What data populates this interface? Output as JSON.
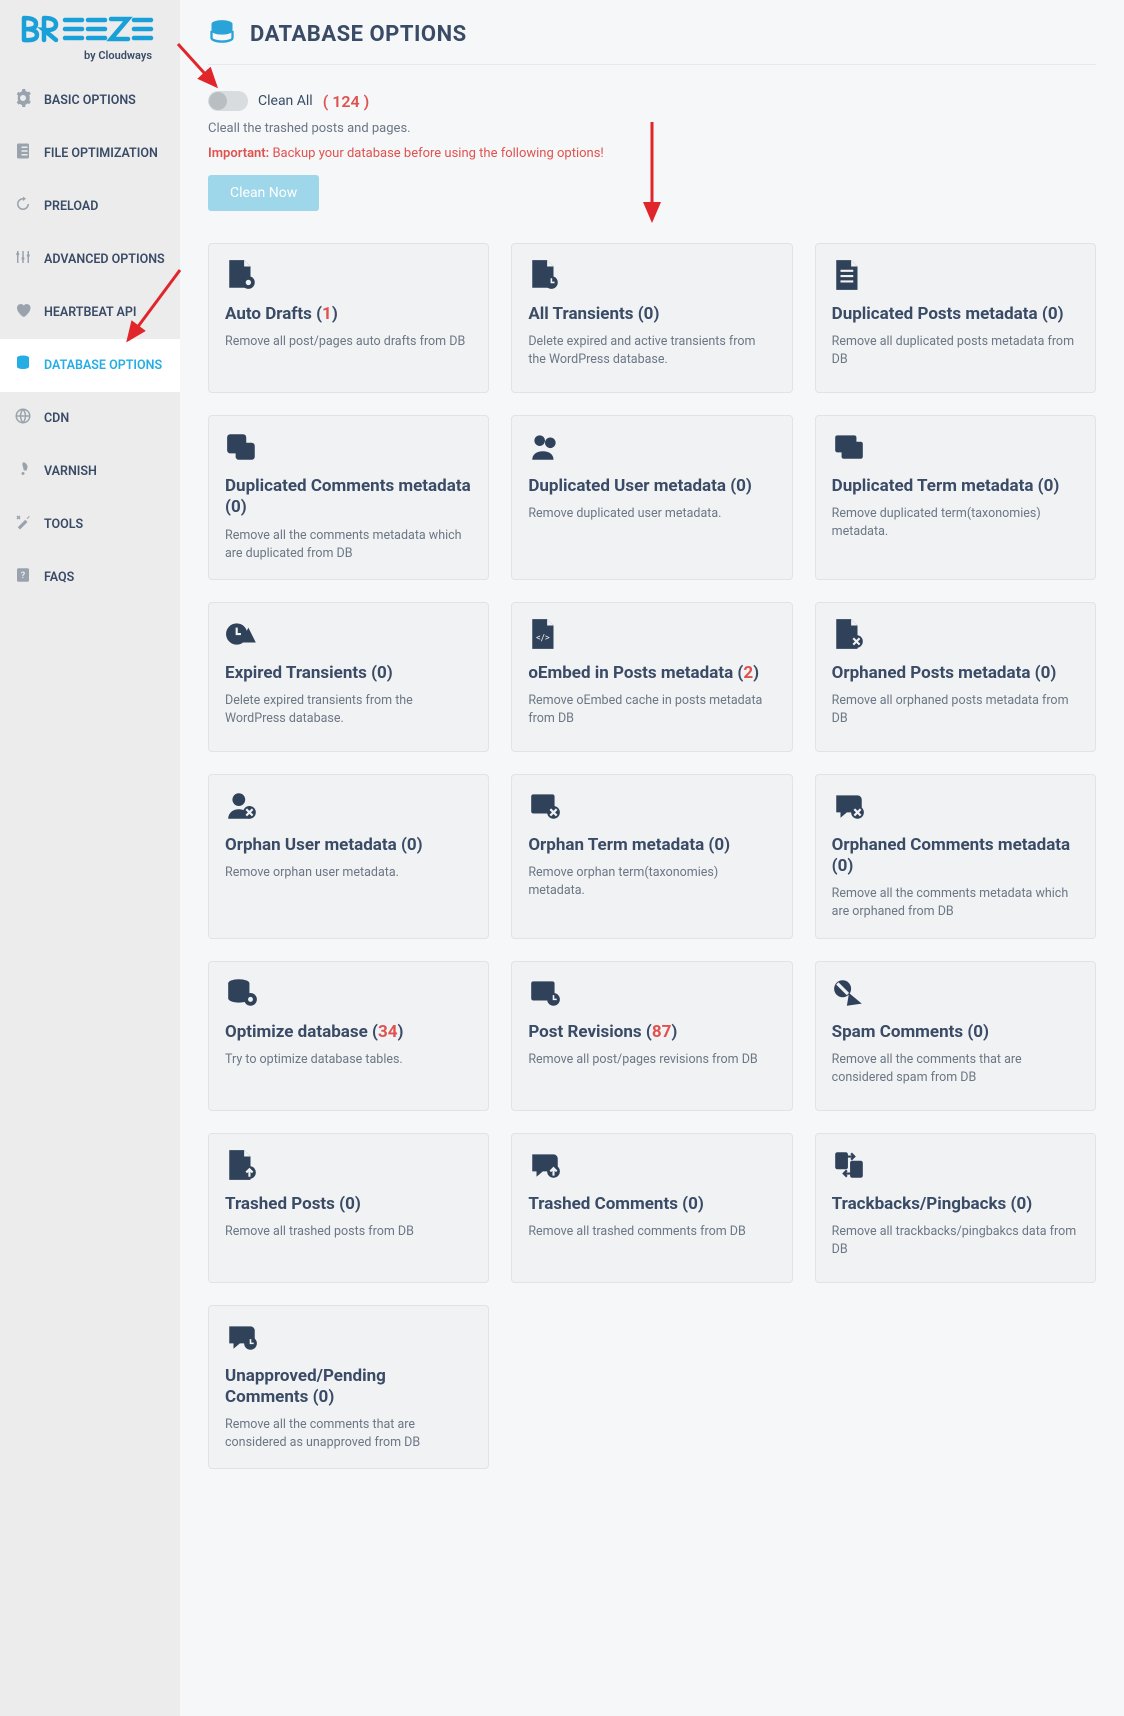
{
  "logo_sub": "by Cloudways",
  "header": {
    "title": "DATABASE OPTIONS"
  },
  "nav": [
    {
      "id": "basic",
      "label": "BASIC OPTIONS"
    },
    {
      "id": "fileopt",
      "label": "FILE OPTIMIZATION"
    },
    {
      "id": "preload",
      "label": "PRELOAD"
    },
    {
      "id": "advanced",
      "label": "ADVANCED OPTIONS"
    },
    {
      "id": "heartbeat",
      "label": "HEARTBEAT API"
    },
    {
      "id": "database",
      "label": "DATABASE OPTIONS",
      "active": true
    },
    {
      "id": "cdn",
      "label": "CDN"
    },
    {
      "id": "varnish",
      "label": "VARNISH"
    },
    {
      "id": "tools",
      "label": "TOOLS"
    },
    {
      "id": "faqs",
      "label": "FAQS"
    }
  ],
  "clean": {
    "label": "Clean All",
    "count_text": "( 124 )",
    "desc": "Cleall the trashed posts and pages.",
    "warn_label": "Important:",
    "warn_text": " Backup your database before using the following options!",
    "button": "Clean Now"
  },
  "cards": [
    {
      "id": "autodrafts",
      "icon": "file-gear",
      "title": "Auto Drafts",
      "count": "1",
      "red": true,
      "desc": "Remove all post/pages auto drafts from DB"
    },
    {
      "id": "alltransients",
      "icon": "file-clock",
      "title": "All Transients",
      "count": "0",
      "red": false,
      "desc": "Delete expired and active transients from the WordPress database."
    },
    {
      "id": "dup-posts-meta",
      "icon": "file-lines",
      "title": "Duplicated Posts metadata",
      "count": "0",
      "red": false,
      "desc": "Remove all duplicated posts metadata from DB"
    },
    {
      "id": "dup-comments-meta",
      "icon": "layers",
      "title": "Duplicated Comments metadata",
      "count": "0",
      "red": false,
      "desc": "Remove all the comments metadata which are duplicated from DB"
    },
    {
      "id": "dup-user-meta",
      "icon": "user-dup",
      "title": "Duplicated User metadata",
      "count": "0",
      "red": false,
      "desc": "Remove duplicated user metadata."
    },
    {
      "id": "dup-term-meta",
      "icon": "term-dup",
      "title": "Duplicated Term metadata",
      "count": "0",
      "red": false,
      "desc": "Remove duplicated term(taxonomies) metadata."
    },
    {
      "id": "exp-transients",
      "icon": "clock-warn",
      "title": "Expired Transients",
      "count": "0",
      "red": false,
      "desc": "Delete expired transients from the WordPress database."
    },
    {
      "id": "oembed",
      "icon": "file-code",
      "title": "oEmbed in Posts metadata",
      "count": "2",
      "red": true,
      "desc": "Remove oEmbed cache in posts metadata from DB"
    },
    {
      "id": "orphan-posts-meta",
      "icon": "file-x",
      "title": "Orphaned Posts metadata",
      "count": "0",
      "red": false,
      "desc": "Remove all orphaned posts metadata from DB"
    },
    {
      "id": "orphan-user-meta",
      "icon": "user-x",
      "title": "Orphan User metadata",
      "count": "0",
      "red": false,
      "desc": "Remove orphan user metadata."
    },
    {
      "id": "orphan-term-meta",
      "icon": "term-x",
      "title": "Orphan Term metadata",
      "count": "0",
      "red": false,
      "desc": "Remove orphan term(taxonomies) metadata."
    },
    {
      "id": "orphan-comments-meta",
      "icon": "comment-x",
      "title": "Orphaned Comments metadata",
      "count": "0",
      "red": false,
      "desc": "Remove all the comments metadata which are orphaned from DB"
    },
    {
      "id": "optimize",
      "icon": "db-gear",
      "title": "Optimize database",
      "count": "34",
      "red": true,
      "desc": "Try to optimize database tables."
    },
    {
      "id": "revisions",
      "icon": "term-clock",
      "title": "Post Revisions",
      "count": "87",
      "red": true,
      "desc": "Remove all post/pages revisions from DB"
    },
    {
      "id": "spam",
      "icon": "spam",
      "title": "Spam Comments",
      "count": "0",
      "red": false,
      "desc": "Remove all the comments that are considered spam from DB"
    },
    {
      "id": "trashed-posts",
      "icon": "file-up",
      "title": "Trashed Posts",
      "count": "0",
      "red": false,
      "desc": "Remove all trashed posts from DB"
    },
    {
      "id": "trashed-comments",
      "icon": "comment-up",
      "title": "Trashed Comments",
      "count": "0",
      "red": false,
      "desc": "Remove all trashed comments from DB"
    },
    {
      "id": "trackbacks",
      "icon": "trackback",
      "title": "Trackbacks/Pingbacks",
      "count": "0",
      "red": false,
      "desc": "Remove all trackbacks/pingbakcs data from DB"
    },
    {
      "id": "pending",
      "icon": "comment-clock",
      "title": "Unapproved/Pending Comments",
      "count": "0",
      "red": false,
      "desc": "Remove all the comments that are considered as unapproved from DB"
    }
  ]
}
